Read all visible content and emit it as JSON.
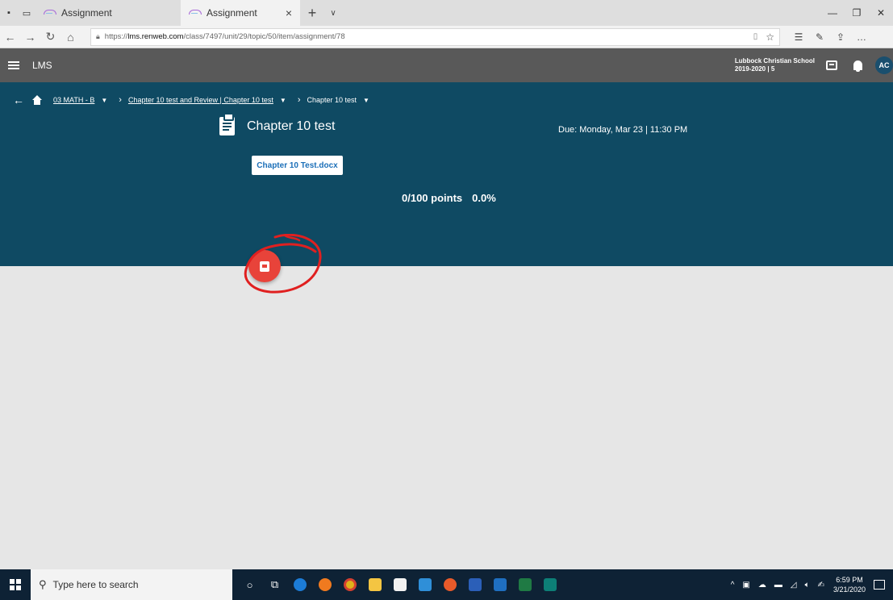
{
  "browser": {
    "tabs": [
      {
        "label": "Assignment",
        "active": false
      },
      {
        "label": "Assignment",
        "active": true
      }
    ],
    "url_prefix": "https://",
    "url_host": "lms.renweb.com",
    "url_path": "/class/7497/unit/29/topic/50/item/assignment/78"
  },
  "appbar": {
    "title": "LMS",
    "school_name": "Lubbock Christian School",
    "school_term": "2019-2020 | 5",
    "avatar_initials": "AC"
  },
  "breadcrumb": {
    "course": "03 MATH - B",
    "unit": "Chapter 10 test and Review  |  Chapter 10 test",
    "item": "Chapter 10 test"
  },
  "assignment": {
    "title": "Chapter 10 test",
    "due": "Due: Monday, Mar 23 | 11:30 PM",
    "attachment": "Chapter 10 Test.docx",
    "points": "0/100 points",
    "percent": "0.0%"
  },
  "taskbar": {
    "search_placeholder": "Type here to search",
    "time": "6:59 PM",
    "date": "3/21/2020"
  },
  "colors": {
    "header_bg": "#0f4a63",
    "appbar_bg": "#595959",
    "fab": "#e8433a",
    "annotation": "#e02020"
  }
}
